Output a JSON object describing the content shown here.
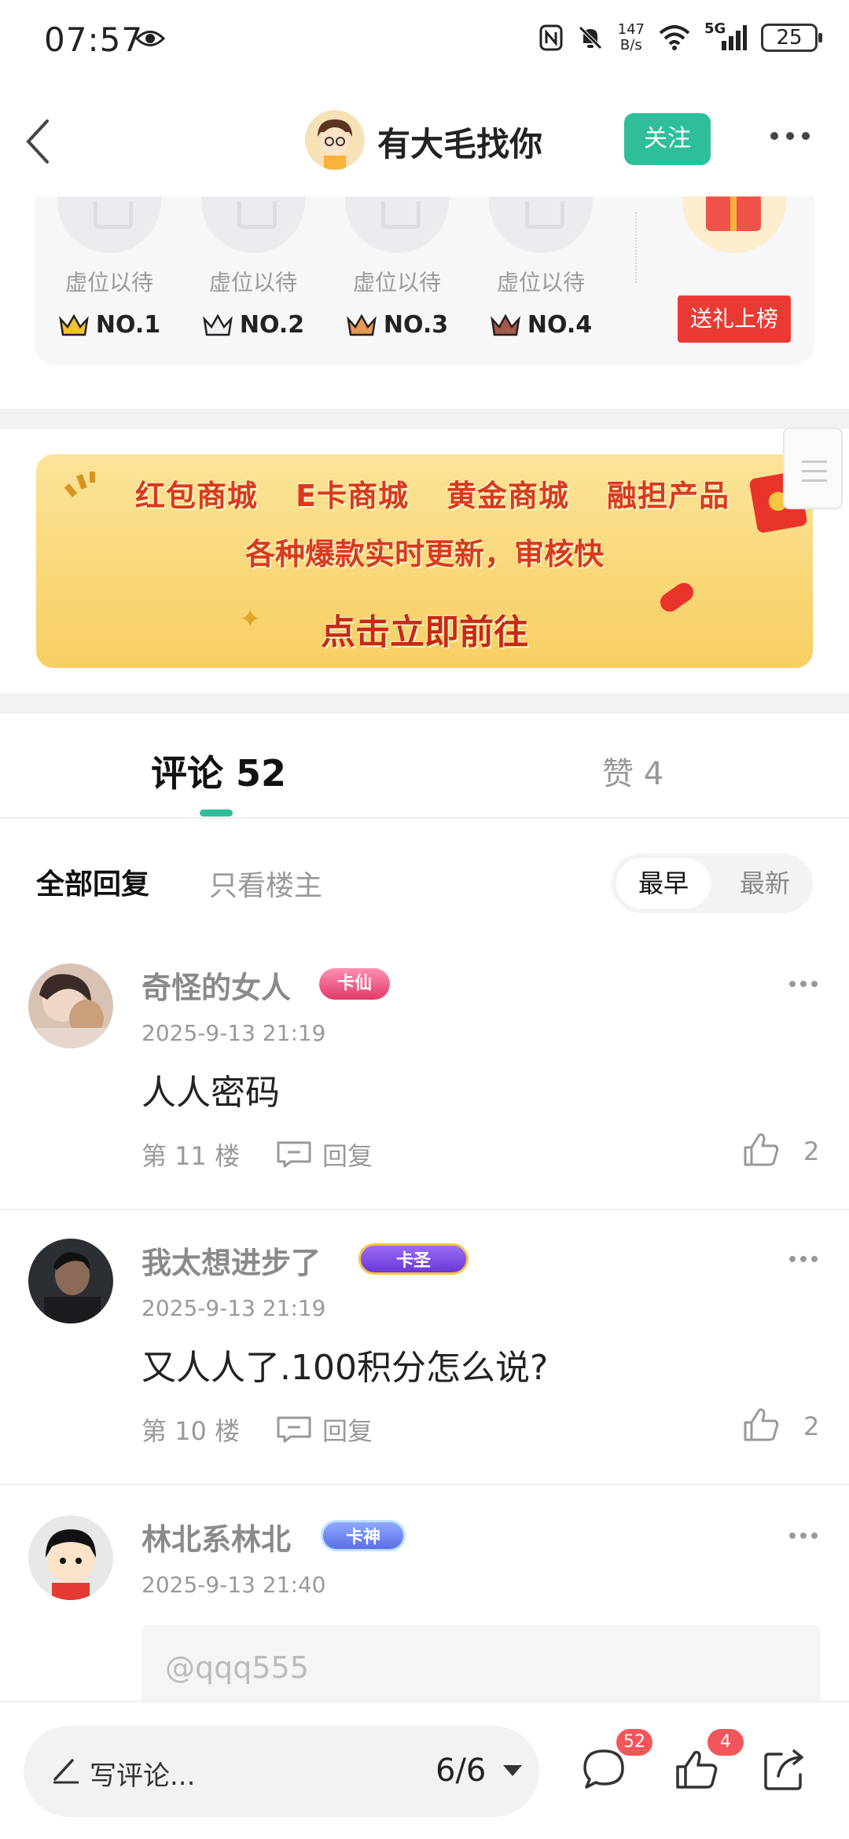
{
  "status_bar": {
    "time": "07:57",
    "speed_value": "147",
    "speed_unit": "B/s",
    "network": "5G",
    "battery": "25"
  },
  "header": {
    "author_name": "有大毛找你",
    "follow_label": "关注"
  },
  "rank": {
    "slots": [
      {
        "text": "虚位以待",
        "rank": "NO.1",
        "crown_color": "#f2c230"
      },
      {
        "text": "虚位以待",
        "rank": "NO.2",
        "crown_color": "#c9ccd6"
      },
      {
        "text": "虚位以待",
        "rank": "NO.3",
        "crown_color": "#e49a54"
      },
      {
        "text": "虚位以待",
        "rank": "NO.4",
        "crown_color": "#a0594b"
      }
    ],
    "send_gift_label": "送礼上榜"
  },
  "banner": {
    "line1": [
      "红包商城",
      "E卡商城",
      "黄金商城",
      "融担产品"
    ],
    "line2": "各种爆款实时更新，审核快",
    "line3": "点击立即前往"
  },
  "tabs": {
    "comments_label": "评论 52",
    "likes_label": "赞 4"
  },
  "filters": {
    "all_label": "全部回复",
    "op_only_label": "只看楼主",
    "sort_earliest": "最早",
    "sort_newest": "最新"
  },
  "comments": [
    {
      "name": "奇怪的女人",
      "badge": "卡仙",
      "time": "2025-9-13 21:19",
      "text": "人人密码",
      "floor": "第 11 楼",
      "reply_label": "回复",
      "likes": "2"
    },
    {
      "name": "我太想进步了",
      "badge": "卡圣",
      "time": "2025-9-13 21:19",
      "text": "又人人了.100积分怎么说?",
      "floor": "第 10 楼",
      "reply_label": "回复",
      "likes": "2"
    },
    {
      "name": "林北系林北",
      "badge": "卡神",
      "time": "2025-9-13 21:40",
      "quote": "@qqq555"
    }
  ],
  "bottom_bar": {
    "write_label": "写评论...",
    "page_indicator": "6/6",
    "comment_count_badge": "52",
    "like_count_badge": "4"
  },
  "colors": {
    "accent": "#2ebf9a",
    "danger": "#ea3a33",
    "badge_red": "#f2555a"
  }
}
